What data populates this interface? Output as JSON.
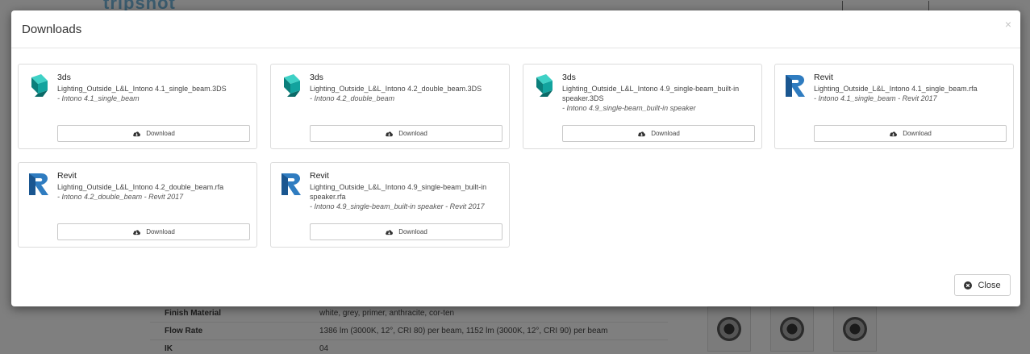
{
  "background": {
    "logo_text": "tripshot",
    "table": [
      {
        "key": "Finish Material",
        "value": "white, grey, primer, anthracite, cor-ten"
      },
      {
        "key": "Flow Rate",
        "value": "1386 lm (3000K, 12°, CRI 80) per beam, 1152 lm (3000K, 12°, CRI 90) per beam"
      },
      {
        "key": "IK",
        "value": "04"
      }
    ]
  },
  "modal": {
    "title": "Downloads",
    "close_x": "×",
    "close_label": "Close",
    "download_label": "Download",
    "files": [
      {
        "type": "3ds",
        "icon": "3ds-icon",
        "name": "Lighting_Outside_L&L_Intono 4.1_single_beam.3DS",
        "desc": "- Intono 4.1_single_beam"
      },
      {
        "type": "3ds",
        "icon": "3ds-icon",
        "name": "Lighting_Outside_L&L_Intono 4.2_double_beam.3DS",
        "desc": "- Intono 4.2_double_beam"
      },
      {
        "type": "3ds",
        "icon": "3ds-icon",
        "name": "Lighting_Outside_L&L_Intono 4.9_single-beam_built-in speaker.3DS",
        "desc": "- Intono 4.9_single-beam_built-in speaker"
      },
      {
        "type": "Revit",
        "icon": "revit-icon",
        "name": "Lighting_Outside_L&L_Intono 4.1_single_beam.rfa",
        "desc": "- Intono 4.1_single_beam - Revit 2017"
      },
      {
        "type": "Revit",
        "icon": "revit-icon",
        "name": "Lighting_Outside_L&L_Intono 4.2_double_beam.rfa",
        "desc": "- Intono 4.2_double_beam - Revit 2017"
      },
      {
        "type": "Revit",
        "icon": "revit-icon",
        "name": "Lighting_Outside_L&L_Intono 4.9_single-beam_built-in speaker.rfa",
        "desc": "- Intono 4.9_single-beam_built-in speaker - Revit 2017"
      }
    ]
  },
  "colors": {
    "3ds_teal": "#1fb5b0",
    "revit_blue": "#1f6fb3"
  }
}
